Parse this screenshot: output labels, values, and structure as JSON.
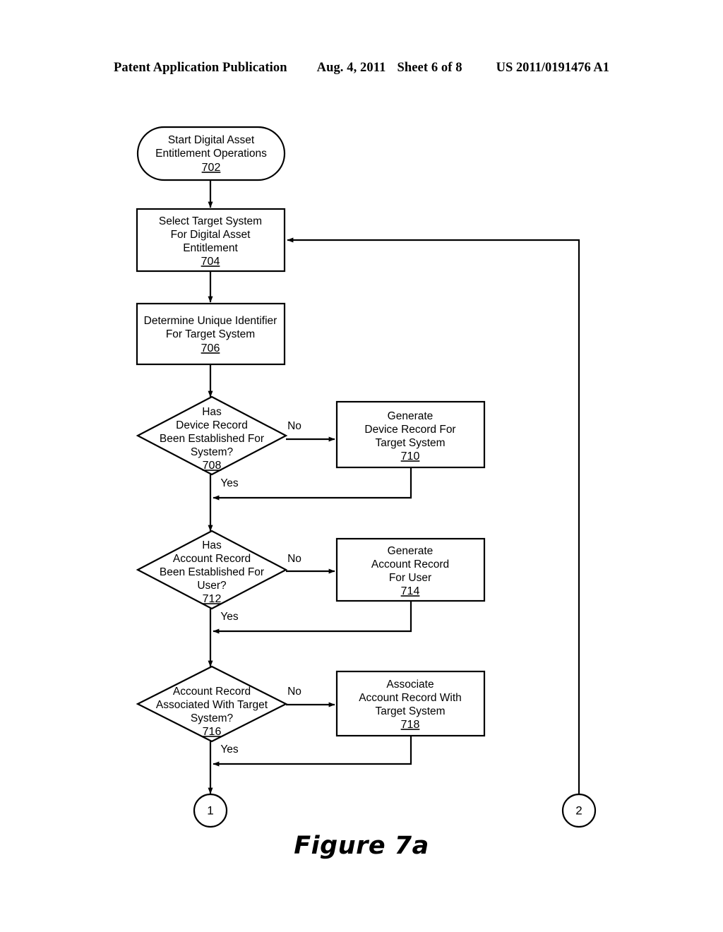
{
  "header": {
    "publication": "Patent Application Publication",
    "date": "Aug. 4, 2011",
    "sheet": "Sheet 6 of 8",
    "number": "US 2011/0191476 A1"
  },
  "figure": {
    "caption": "Figure 7a"
  },
  "flowchart": {
    "nodes": {
      "n702": {
        "type": "terminator",
        "lines": [
          "Start Digital Asset",
          "Entitlement Operations"
        ],
        "ref": "702"
      },
      "n704": {
        "type": "process",
        "lines": [
          "Select Target System",
          "For Digital Asset",
          "Entitlement"
        ],
        "ref": "704"
      },
      "n706": {
        "type": "process",
        "lines": [
          "Determine Unique Identifier",
          "For Target System"
        ],
        "ref": "706"
      },
      "n708": {
        "type": "decision",
        "lines": [
          "Has",
          "Device Record",
          "Been Established For",
          "System?"
        ],
        "ref": "708"
      },
      "n710": {
        "type": "process",
        "lines": [
          "Generate",
          "Device Record For",
          "Target System"
        ],
        "ref": "710"
      },
      "n712": {
        "type": "decision",
        "lines": [
          "Has",
          "Account Record",
          "Been Established For",
          "User?"
        ],
        "ref": "712"
      },
      "n714": {
        "type": "process",
        "lines": [
          "Generate",
          "Account Record",
          "For User"
        ],
        "ref": "714"
      },
      "n716": {
        "type": "decision",
        "lines": [
          "Account Record",
          "Associated With Target",
          "System?"
        ],
        "ref": "716"
      },
      "n718": {
        "type": "process",
        "lines": [
          "Associate",
          "Account Record With",
          "Target System"
        ],
        "ref": "718"
      },
      "connector1": {
        "type": "connector",
        "ref": "1"
      },
      "connector2": {
        "type": "connector",
        "ref": "2"
      }
    },
    "edge_labels": {
      "no_708": "No",
      "yes_708": "Yes",
      "no_712": "No",
      "yes_712": "Yes",
      "no_716": "No",
      "yes_716": "Yes"
    }
  }
}
